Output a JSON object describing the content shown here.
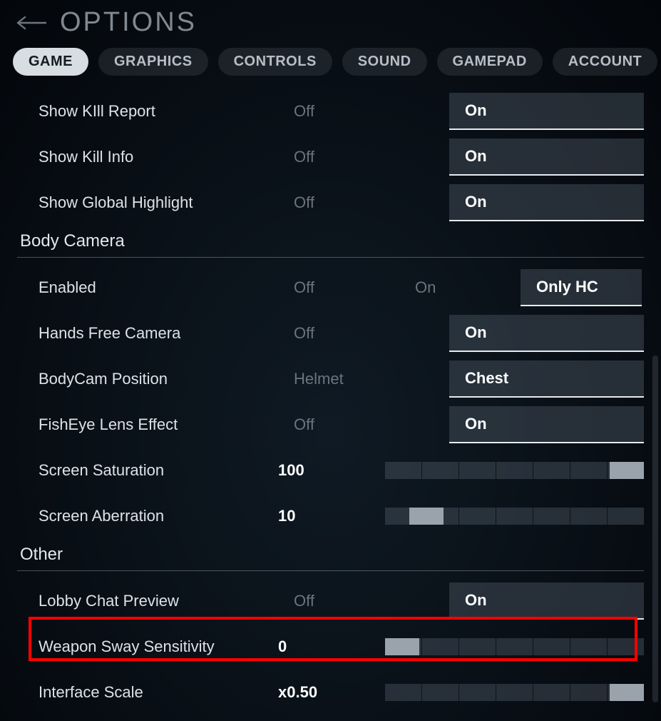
{
  "header": {
    "title": "OPTIONS"
  },
  "tabs": [
    "GAME",
    "GRAPHICS",
    "CONTROLS",
    "SOUND",
    "GAMEPAD",
    "ACCOUNT"
  ],
  "active_tab": 0,
  "rows": {
    "kill_report": {
      "label": "Show KIll Report",
      "off": "Off",
      "on": "On"
    },
    "kill_info": {
      "label": "Show Kill Info",
      "off": "Off",
      "on": "On"
    },
    "global_hl": {
      "label": "Show Global Highlight",
      "off": "Off",
      "on": "On"
    },
    "enabled": {
      "label": "Enabled",
      "off": "Off",
      "on": "On",
      "only": "Only HC"
    },
    "hands_free": {
      "label": "Hands Free Camera",
      "off": "Off",
      "on": "On"
    },
    "bodycam_pos": {
      "label": "BodyCam Position",
      "opt1": "Helmet",
      "opt2": "Chest"
    },
    "fisheye": {
      "label": "FishEye Lens Effect",
      "off": "Off",
      "on": "On"
    },
    "saturation": {
      "label": "Screen Saturation",
      "value": "100"
    },
    "aberration": {
      "label": "Screen Aberration",
      "value": "10"
    },
    "lobby_chat": {
      "label": "Lobby Chat Preview",
      "off": "Off",
      "on": "On"
    },
    "weapon_sway": {
      "label": "Weapon Sway Sensitivity",
      "value": "0"
    },
    "iface_scale": {
      "label": "Interface Scale",
      "value": "x0.50"
    }
  },
  "sections": {
    "body_camera": "Body Camera",
    "other": "Other"
  }
}
